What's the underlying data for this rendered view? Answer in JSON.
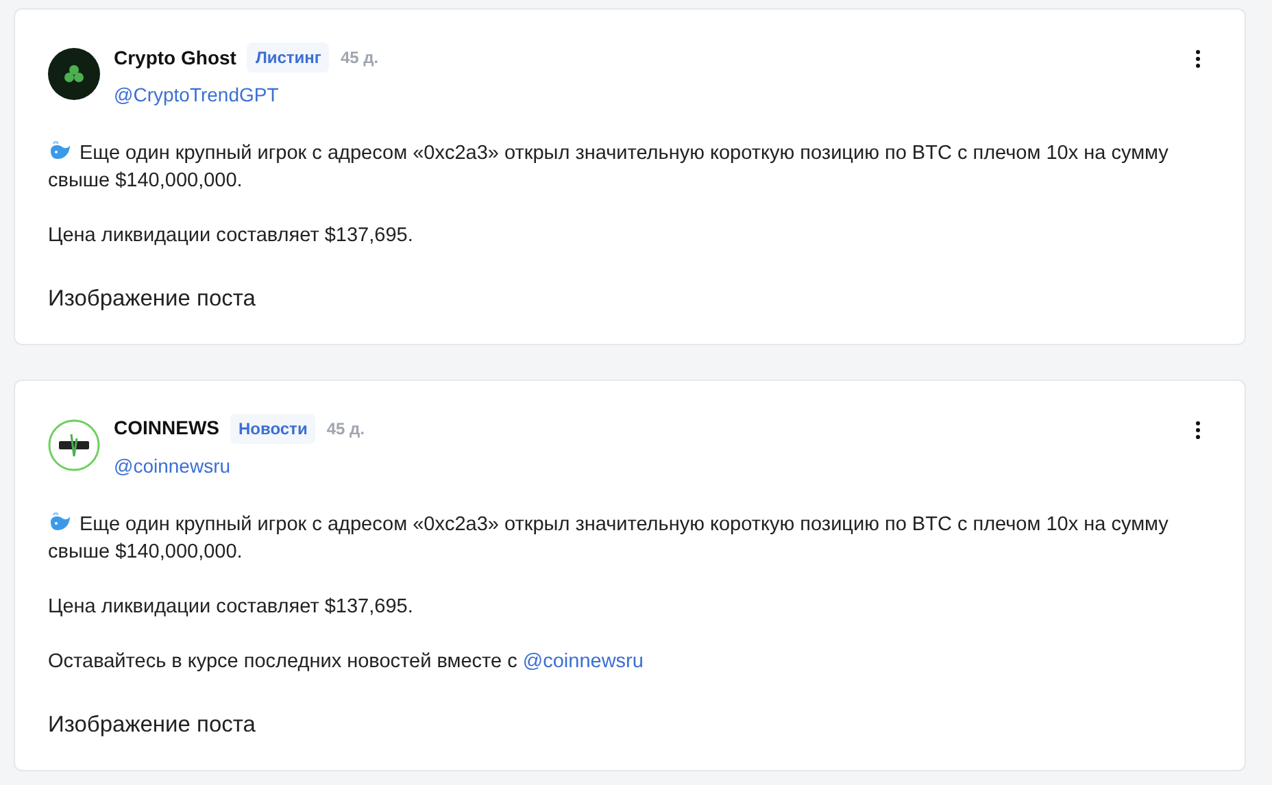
{
  "posts": [
    {
      "author": "Crypto Ghost",
      "kind": "ghost",
      "tag": "Листинг",
      "time": "45 д.",
      "handle": "@CryptoTrendGPT",
      "paragraphs": [
        {
          "whale": true,
          "text": "Еще один крупный игрок с адресом «0xc2a3» открыл значительную короткую позицию по BTC с плечом 10x на сумму свыше $140,000,000."
        },
        {
          "whale": false,
          "text": "Цена ликвидации составляет $137,695."
        }
      ],
      "image_label": "Изображение поста"
    },
    {
      "author": "COINNEWS",
      "kind": "news",
      "tag": "Новости",
      "time": "45 д.",
      "handle": "@coinnewsru",
      "paragraphs": [
        {
          "whale": true,
          "text": "Еще один крупный игрок с адресом «0xc2a3» открыл значительную короткую позицию по BTC с плечом 10x на сумму свыше $140,000,000."
        },
        {
          "whale": false,
          "text": "Цена ликвидации составляет $137,695."
        },
        {
          "whale": false,
          "text": "Оставайтесь в курсе последних новостей вместе с",
          "link": "@coinnewsru"
        }
      ],
      "image_label": "Изображение поста"
    }
  ]
}
